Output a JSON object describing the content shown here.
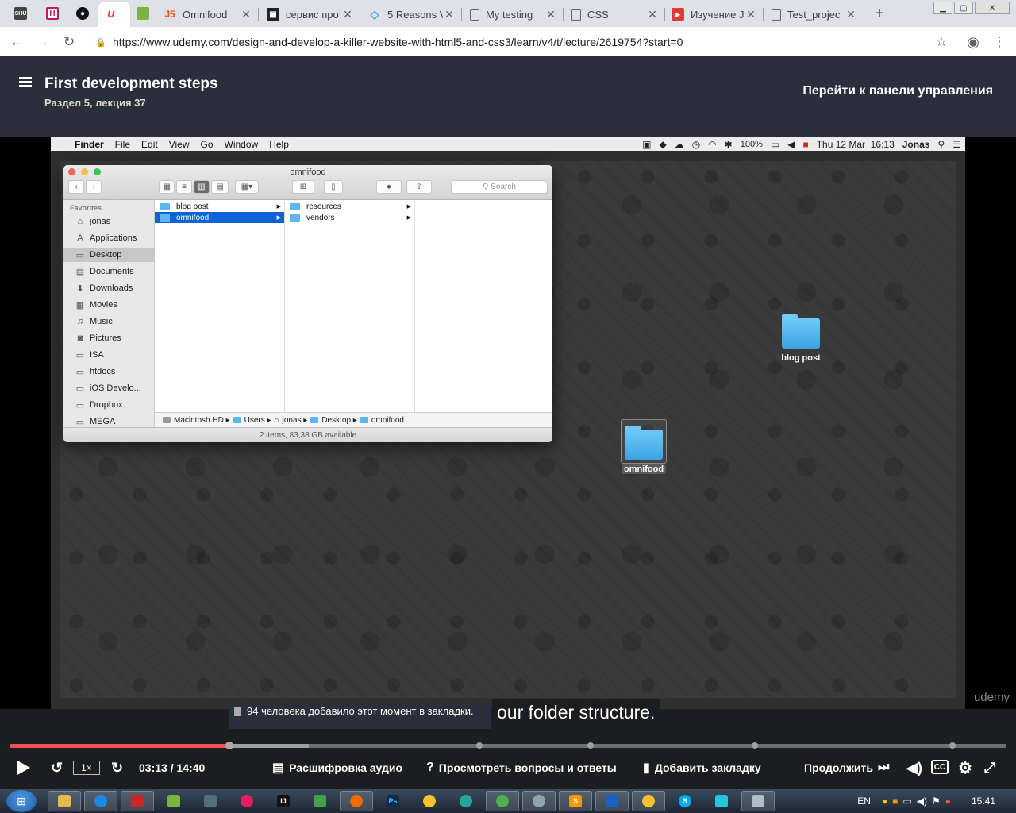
{
  "browser": {
    "tabs": [
      {
        "title": "Omnifood",
        "favicon": "js-icon",
        "color": "#e65100"
      },
      {
        "title": "сервис про",
        "favicon": "app-icon",
        "color": "#222"
      },
      {
        "title": "5 Reasons V",
        "favicon": "diamond-icon",
        "color": "#4ba3e3"
      },
      {
        "title": "My testing",
        "favicon": "doc-icon",
        "color": "#5f6368"
      },
      {
        "title": "CSS",
        "favicon": "doc-icon",
        "color": "#5f6368"
      },
      {
        "title": "Изучение J",
        "favicon": "youtube-icon",
        "color": "#e53935"
      },
      {
        "title": "Test_projec",
        "favicon": "doc-icon",
        "color": "#5f6368"
      }
    ],
    "url": "https://www.udemy.com/design-and-develop-a-killer-website-with-html5-and-css3/learn/v4/t/lecture/2619754?start=0"
  },
  "header": {
    "title": "First development steps",
    "subtitle": "Раздел 5, лекция 37",
    "dashboard_link": "Перейти к панели управления"
  },
  "mac": {
    "menubar": {
      "items": [
        "Finder",
        "File",
        "Edit",
        "View",
        "Go",
        "Window",
        "Help"
      ],
      "battery": "100%",
      "clock": "Thu 12 Mar  16:13",
      "user": "Jonas"
    },
    "finder": {
      "title": "omnifood",
      "search_placeholder": "Search",
      "favorites_label": "Favorites",
      "sidebar": [
        "jonas",
        "Applications",
        "Desktop",
        "Documents",
        "Downloads",
        "Movies",
        "Music",
        "Pictures",
        "ISA",
        "htdocs",
        "iOS Develo...",
        "Dropbox",
        "MEGA"
      ],
      "col1": [
        "blog post",
        "omnifood"
      ],
      "col2": [
        "resources",
        "vendors"
      ],
      "path": [
        "Macintosh HD",
        "Users",
        "jonas",
        "Desktop",
        "omnifood"
      ],
      "status": "2 items, 83,38 GB available"
    },
    "desktop_icons": [
      "blog post",
      "omnifood"
    ],
    "watermark": "udemy"
  },
  "overlay": {
    "bookmark_note": "94 человека добавило этот момент в закладки.",
    "caption": "our folder structure."
  },
  "player": {
    "progress": 0.2204,
    "buffered": 0.3005,
    "speed": "1×",
    "time": "03:13 / 14:40",
    "transcript": "Расшифровка аудио",
    "qa": "Просмотреть вопросы и ответы",
    "add_bookmark": "Добавить закладку",
    "continue": "Продолжить",
    "cc": "CC"
  },
  "taskbar": {
    "lang": "EN",
    "clock": "15:41"
  }
}
